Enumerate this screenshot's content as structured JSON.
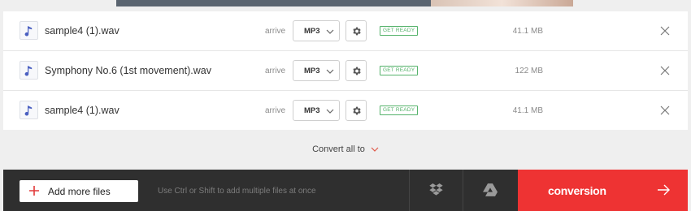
{
  "files": [
    {
      "name": "sample4 (1).wav",
      "arrive": "arrive",
      "format": "MP3",
      "status": "GET READY",
      "size": "41.1 MB",
      "icon": "music-note-icon"
    },
    {
      "name": "Symphony No.6 (1st movement).wav",
      "arrive": "arrive",
      "format": "MP3",
      "status": "GET READY",
      "size": "122 MB",
      "icon": "music-note-icon"
    },
    {
      "name": "sample4 (1).wav",
      "arrive": "arrive",
      "format": "MP3",
      "status": "GET READY",
      "size": "41.1 MB",
      "icon": "music-note-icon"
    }
  ],
  "convert_all": {
    "label": "Convert all to"
  },
  "bottom_bar": {
    "add_files_label": "Add more files",
    "hint": "Use Ctrl or Shift to add multiple files at once",
    "convert_label": "conversion",
    "icons": [
      "plus-icon",
      "dropbox-icon",
      "google-drive-icon",
      "arrow-right-icon"
    ]
  },
  "colors": {
    "accent": "#ee3333",
    "status_green": "#54b26a",
    "bar_dark": "#2f2f2f"
  }
}
